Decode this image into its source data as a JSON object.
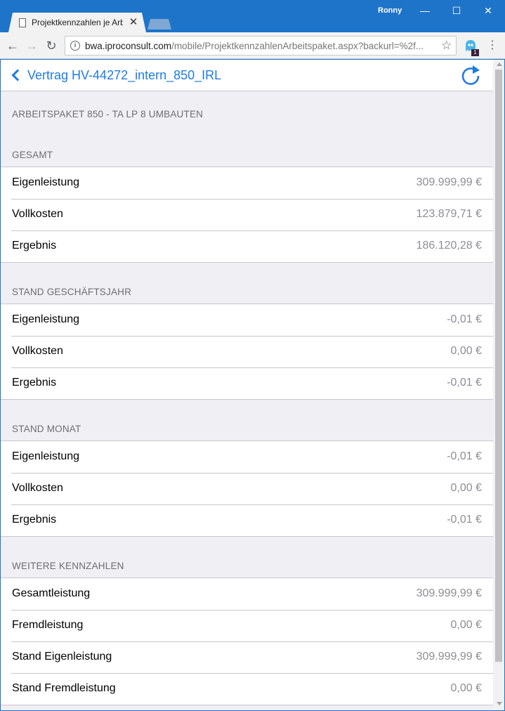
{
  "browser": {
    "tab_title": "Projektkennzahlen je Arbeitspaket",
    "user": "Ronny",
    "url_host": "bwa.iproconsult.com",
    "url_path": "/mobile/ProjektkennzahlenArbeitspaket.aspx?backurl=%2f..."
  },
  "nav": {
    "back_label": "Vertrag HV-44272_intern_850_IRL"
  },
  "package_title": "ARBEITSPAKET 850 - TA LP 8 UMBAUTEN",
  "sections": [
    {
      "title": "GESAMT",
      "rows": [
        {
          "label": "Eigenleistung",
          "value": "309.999,99 €"
        },
        {
          "label": "Vollkosten",
          "value": "123.879,71 €"
        },
        {
          "label": "Ergebnis",
          "value": "186.120,28 €"
        }
      ]
    },
    {
      "title": "STAND GESCHÄFTSJAHR",
      "rows": [
        {
          "label": "Eigenleistung",
          "value": "-0,01 €"
        },
        {
          "label": "Vollkosten",
          "value": "0,00 €"
        },
        {
          "label": "Ergebnis",
          "value": "-0,01 €"
        }
      ]
    },
    {
      "title": "STAND MONAT",
      "rows": [
        {
          "label": "Eigenleistung",
          "value": "-0,01 €"
        },
        {
          "label": "Vollkosten",
          "value": "0,00 €"
        },
        {
          "label": "Ergebnis",
          "value": "-0,01 €"
        }
      ]
    },
    {
      "title": "WEITERE KENNZAHLEN",
      "rows": [
        {
          "label": "Gesamtleistung",
          "value": "309.999,99 €"
        },
        {
          "label": "Fremdleistung",
          "value": "0,00 €"
        },
        {
          "label": "Stand Eigenleistung",
          "value": "309.999,99 €"
        },
        {
          "label": "Stand Fremdleistung",
          "value": "0,00 €"
        }
      ]
    }
  ],
  "colors": {
    "accent": "#1f7ce0",
    "window_frame": "#1e74c8",
    "group_background": "#efeff4",
    "value_text": "#8e8e93"
  },
  "icons": [
    "page-icon",
    "close-icon",
    "back-arrow-icon",
    "forward-arrow-icon",
    "reload-icon",
    "info-icon",
    "star-icon",
    "extension-icon",
    "menu-icon",
    "chevron-left-icon",
    "refresh-icon"
  ]
}
